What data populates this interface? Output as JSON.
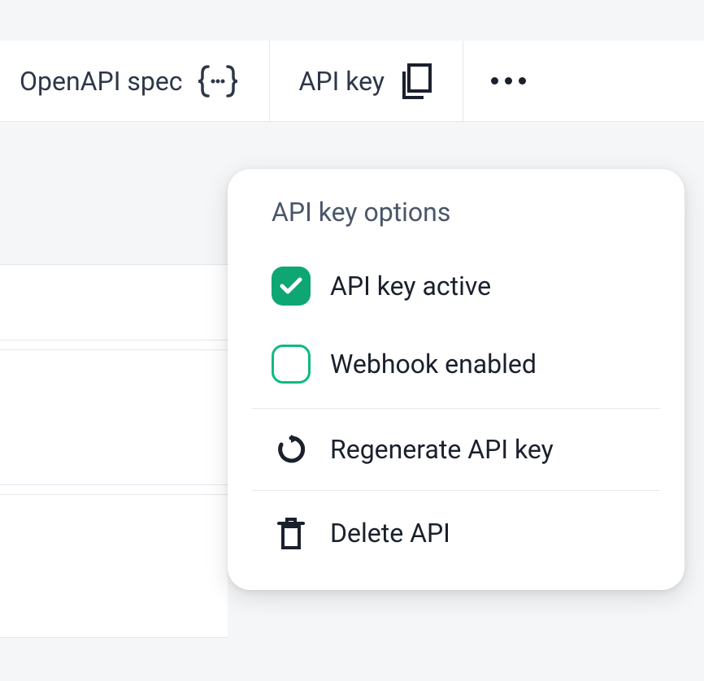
{
  "toolbar": {
    "openapi_label": "OpenAPI spec",
    "apikey_label": "API key"
  },
  "dropdown": {
    "title": "API key options",
    "items": {
      "active": "API key active",
      "webhook": "Webhook enabled",
      "regenerate": "Regenerate API key",
      "delete": "Delete API"
    }
  }
}
